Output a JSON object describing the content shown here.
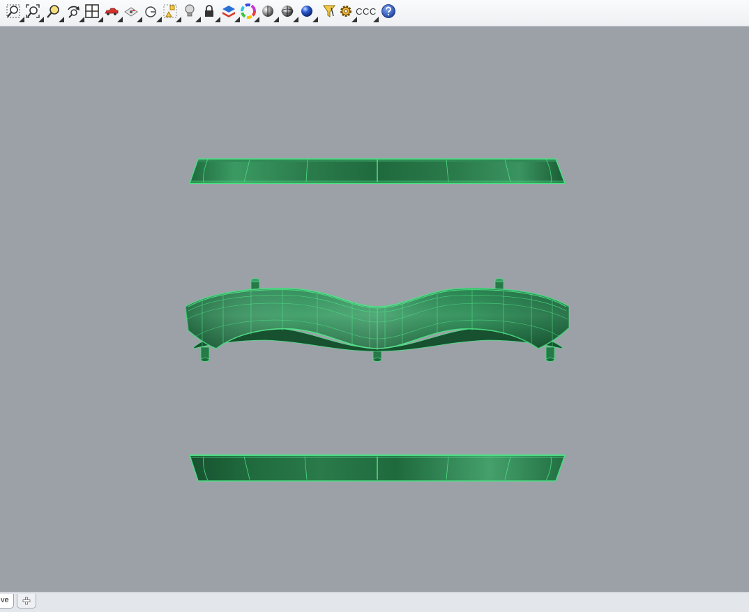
{
  "toolbar": {
    "buttons": [
      {
        "name": "zoom-window-icon"
      },
      {
        "name": "zoom-extents-icon"
      },
      {
        "name": "zoom-selected-icon"
      },
      {
        "name": "rotate-view-icon"
      },
      {
        "name": "four-viewports-icon"
      },
      {
        "name": "car-icon"
      },
      {
        "name": "named-views-icon"
      },
      {
        "name": "set-cplane-icon"
      },
      {
        "name": "object-snap-icon"
      },
      {
        "name": "light-bulb-icon"
      },
      {
        "name": "lock-icon"
      },
      {
        "name": "layer-icon"
      },
      {
        "name": "color-wheel-icon"
      },
      {
        "name": "shaded-sphere-icon"
      },
      {
        "name": "rendered-sphere-icon"
      },
      {
        "name": "render-blue-sphere-icon"
      },
      {
        "name": "select-filter-icon"
      },
      {
        "name": "options-gear-icon"
      },
      {
        "name": "help-icon"
      }
    ],
    "text_button_label": "CCC"
  },
  "viewport_tabs": {
    "active_tab_label": "ve",
    "add_tab_icon": "plus-icon"
  },
  "colors": {
    "viewport_background": "#9ba1a7",
    "model_dark": "#1e6b3e",
    "model_mid": "#2f8a55",
    "model_edge": "#4dde84"
  }
}
